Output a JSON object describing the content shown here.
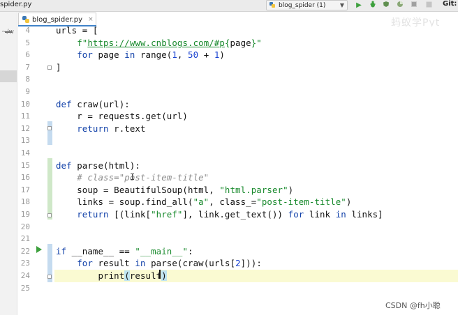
{
  "window": {
    "file_title": "spider.py",
    "git_label": "Git:",
    "watermark_top": "蚂蚁学Pyt"
  },
  "tabs": [
    {
      "label": "blog_spider.py",
      "close": "×"
    }
  ],
  "run_config": {
    "label": "blog_spider (1)",
    "caret": "▼"
  },
  "toolbar": {
    "run_icon": "▶",
    "debug_icon": "🐞",
    "coverage_icon": "⛨",
    "profile_icon": "◔",
    "concurrency_icon": "≡",
    "stop_icon": "■"
  },
  "sidebar": {
    "path": "~/w"
  },
  "editor": {
    "lines": [
      {
        "num": "4",
        "html": "urls = ["
      },
      {
        "num": "5",
        "html": "    <span class=\"str\">f\"</span><span class=\"url\">https://www.cnblogs.com/#p</span><span class=\"str\">{</span>page<span class=\"str\">}\"</span>"
      },
      {
        "num": "6",
        "html": "    <span class=\"kw\">for</span> page <span class=\"kw\">in</span> range(<span class=\"num\">1</span>, <span class=\"num\">50</span> + <span class=\"num\">1</span>)"
      },
      {
        "num": "7",
        "html": "]"
      },
      {
        "num": "8",
        "html": ""
      },
      {
        "num": "9",
        "html": ""
      },
      {
        "num": "10",
        "html": "<span class=\"kw\">def</span> craw(url):"
      },
      {
        "num": "11",
        "html": "    r = requests.get(url)"
      },
      {
        "num": "12",
        "html": "    <span class=\"kw\">return</span> r.text"
      },
      {
        "num": "13",
        "html": ""
      },
      {
        "num": "14",
        "html": ""
      },
      {
        "num": "15",
        "html": "<span class=\"kw\">def</span> parse(html):"
      },
      {
        "num": "16",
        "html": "    <span class=\"cmt\"># class=\"post-item-title\"</span>"
      },
      {
        "num": "17",
        "html": "    soup = BeautifulSoup(html, <span class=\"str\">\"html.parser\"</span>)"
      },
      {
        "num": "18",
        "html": "    links = soup.find_all(<span class=\"str\">\"a\"</span>, class_=<span class=\"str\">\"post-item-title\"</span>)"
      },
      {
        "num": "19",
        "html": "    <span class=\"kw\">return</span> [(link[<span class=\"str\">\"href\"</span>], link.get_text()) <span class=\"kw\">for</span> link <span class=\"kw\">in</span> links]"
      },
      {
        "num": "20",
        "html": ""
      },
      {
        "num": "21",
        "html": ""
      },
      {
        "num": "22",
        "html": "<span class=\"kw\">if</span> __name__ == <span class=\"str\">\"__main__\"</span>:"
      },
      {
        "num": "23",
        "html": "    <span class=\"kw\">for</span> result <span class=\"kw\">in</span> parse(craw(urls[<span class=\"num\">2</span>])):"
      },
      {
        "num": "24",
        "html": "        print<span class=\"paren-hl\">(</span>result<span class=\"paren-hl\">)</span>"
      },
      {
        "num": "25",
        "html": ""
      }
    ]
  },
  "footer": {
    "watermark": "CSDN @fh小聪"
  },
  "colors": {
    "keyword": "#0f3fa8",
    "string": "#198a2d",
    "comment": "#8c8c8c",
    "number": "#1740d0",
    "run_green": "#3da03d",
    "tab_accent": "#4083c9"
  }
}
